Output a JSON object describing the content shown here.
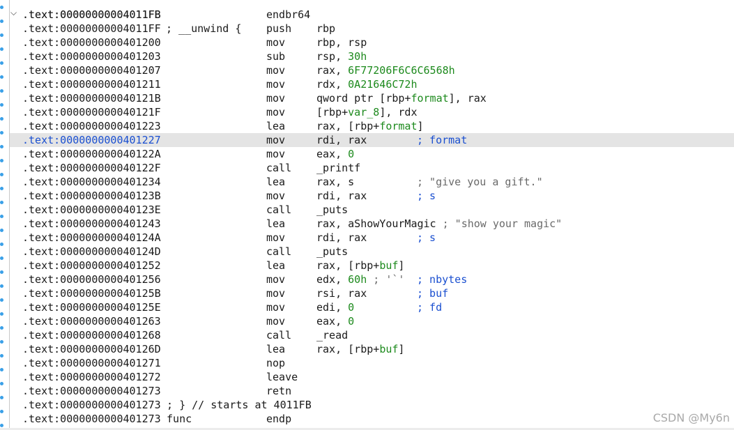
{
  "top_partial": {
    "address": ".text:00000000004011FB",
    "comment": "; __unwind {"
  },
  "rows": [
    {
      "address": ".text:00000000004011FB",
      "mnemonic": "endbr64",
      "operands": [],
      "comment": ""
    },
    {
      "address": ".text:00000000004011FF",
      "mnemonic": "push",
      "operands": [
        {
          "t": "rbp",
          "c": "sub"
        }
      ],
      "comment": ""
    },
    {
      "address": ".text:0000000000401200",
      "mnemonic": "mov",
      "operands": [
        {
          "t": "rbp, rsp",
          "c": "sub"
        }
      ],
      "comment": ""
    },
    {
      "address": ".text:0000000000401203",
      "mnemonic": "sub",
      "operands": [
        {
          "t": "rsp, ",
          "c": "sub"
        },
        {
          "t": "30h",
          "c": "num"
        }
      ],
      "comment": ""
    },
    {
      "address": ".text:0000000000401207",
      "mnemonic": "mov",
      "operands": [
        {
          "t": "rax, ",
          "c": "sub"
        },
        {
          "t": "6F77206F6C6C6568h",
          "c": "num"
        }
      ],
      "comment": ""
    },
    {
      "address": ".text:0000000000401211",
      "mnemonic": "mov",
      "operands": [
        {
          "t": "rdx, ",
          "c": "sub"
        },
        {
          "t": "0A21646C72h",
          "c": "num"
        }
      ],
      "comment": ""
    },
    {
      "address": ".text:000000000040121B",
      "mnemonic": "mov",
      "operands": [
        {
          "t": "qword ptr [rbp+",
          "c": "sub"
        },
        {
          "t": "format",
          "c": "var"
        },
        {
          "t": "], rax",
          "c": "sub"
        }
      ],
      "comment": ""
    },
    {
      "address": ".text:000000000040121F",
      "mnemonic": "mov",
      "operands": [
        {
          "t": "[rbp+",
          "c": "sub"
        },
        {
          "t": "var_8",
          "c": "var"
        },
        {
          "t": "], rdx",
          "c": "sub"
        }
      ],
      "comment": ""
    },
    {
      "address": ".text:0000000000401223",
      "mnemonic": "lea",
      "operands": [
        {
          "t": "rax, [rbp+",
          "c": "sub"
        },
        {
          "t": "format",
          "c": "var"
        },
        {
          "t": "]",
          "c": "sub"
        }
      ],
      "comment": ""
    },
    {
      "address": ".text:0000000000401227",
      "mnemonic": "mov",
      "operands": [
        {
          "t": "rdi, rax",
          "c": "sub"
        }
      ],
      "comment": "; format",
      "highlighted": true
    },
    {
      "address": ".text:000000000040122A",
      "mnemonic": "mov",
      "operands": [
        {
          "t": "eax, ",
          "c": "sub"
        },
        {
          "t": "0",
          "c": "num"
        }
      ],
      "comment": ""
    },
    {
      "address": ".text:000000000040122F",
      "mnemonic": "call",
      "operands": [
        {
          "t": "_printf",
          "c": "sub"
        }
      ],
      "comment": ""
    },
    {
      "address": ".text:0000000000401234",
      "mnemonic": "lea",
      "operands": [
        {
          "t": "rax, s",
          "c": "sub"
        }
      ],
      "comment": "; \"give you a gift.\"",
      "comment_gray": true
    },
    {
      "address": ".text:000000000040123B",
      "mnemonic": "mov",
      "operands": [
        {
          "t": "rdi, rax",
          "c": "sub"
        }
      ],
      "comment": "; s"
    },
    {
      "address": ".text:000000000040123E",
      "mnemonic": "call",
      "operands": [
        {
          "t": "_puts",
          "c": "sub"
        }
      ],
      "comment": ""
    },
    {
      "address": ".text:0000000000401243",
      "mnemonic": "lea",
      "operands": [
        {
          "t": "rax, aShowYourMagic ",
          "c": "sub"
        },
        {
          "t": "; \"show your magic\"",
          "c": "gray"
        }
      ],
      "comment": ""
    },
    {
      "address": ".text:000000000040124A",
      "mnemonic": "mov",
      "operands": [
        {
          "t": "rdi, rax",
          "c": "sub"
        }
      ],
      "comment": "; s"
    },
    {
      "address": ".text:000000000040124D",
      "mnemonic": "call",
      "operands": [
        {
          "t": "_puts",
          "c": "sub"
        }
      ],
      "comment": ""
    },
    {
      "address": ".text:0000000000401252",
      "mnemonic": "lea",
      "operands": [
        {
          "t": "rax, [rbp+",
          "c": "sub"
        },
        {
          "t": "buf",
          "c": "var"
        },
        {
          "t": "]",
          "c": "sub"
        }
      ],
      "comment": ""
    },
    {
      "address": ".text:0000000000401256",
      "mnemonic": "mov",
      "operands": [
        {
          "t": "edx, ",
          "c": "sub"
        },
        {
          "t": "60h",
          "c": "num"
        },
        {
          "t": " ; '`'",
          "c": "gray"
        }
      ],
      "comment": "; nbytes"
    },
    {
      "address": ".text:000000000040125B",
      "mnemonic": "mov",
      "operands": [
        {
          "t": "rsi, rax",
          "c": "sub"
        }
      ],
      "comment": "; buf"
    },
    {
      "address": ".text:000000000040125E",
      "mnemonic": "mov",
      "operands": [
        {
          "t": "edi, ",
          "c": "sub"
        },
        {
          "t": "0",
          "c": "num"
        }
      ],
      "comment": "; fd"
    },
    {
      "address": ".text:0000000000401263",
      "mnemonic": "mov",
      "operands": [
        {
          "t": "eax, ",
          "c": "sub"
        },
        {
          "t": "0",
          "c": "num"
        }
      ],
      "comment": ""
    },
    {
      "address": ".text:0000000000401268",
      "mnemonic": "call",
      "operands": [
        {
          "t": "_read",
          "c": "sub"
        }
      ],
      "comment": ""
    },
    {
      "address": ".text:000000000040126D",
      "mnemonic": "lea",
      "operands": [
        {
          "t": "rax, [rbp+",
          "c": "sub"
        },
        {
          "t": "buf",
          "c": "var"
        },
        {
          "t": "]",
          "c": "sub"
        }
      ],
      "comment": ""
    },
    {
      "address": ".text:0000000000401271",
      "mnemonic": "nop",
      "operands": [],
      "comment": ""
    },
    {
      "address": ".text:0000000000401272",
      "mnemonic": "leave",
      "operands": [],
      "comment": ""
    },
    {
      "address": ".text:0000000000401273",
      "mnemonic": "retn",
      "operands": [],
      "comment": ""
    }
  ],
  "tail_rows": [
    {
      "address": ".text:0000000000401273",
      "text": " ; } // starts at 4011FB"
    },
    {
      "address": ".text:0000000000401273",
      "text": " func",
      "mnemonic": "endp"
    }
  ],
  "watermark": "CSDN @My6n",
  "fold_icon": "chevron-down-icon",
  "colors": {
    "number": "#1d8a1d",
    "comment": "#1a4fd0",
    "highlight": "#e4e4e4",
    "gutter_dot": "#3aa0e8"
  }
}
